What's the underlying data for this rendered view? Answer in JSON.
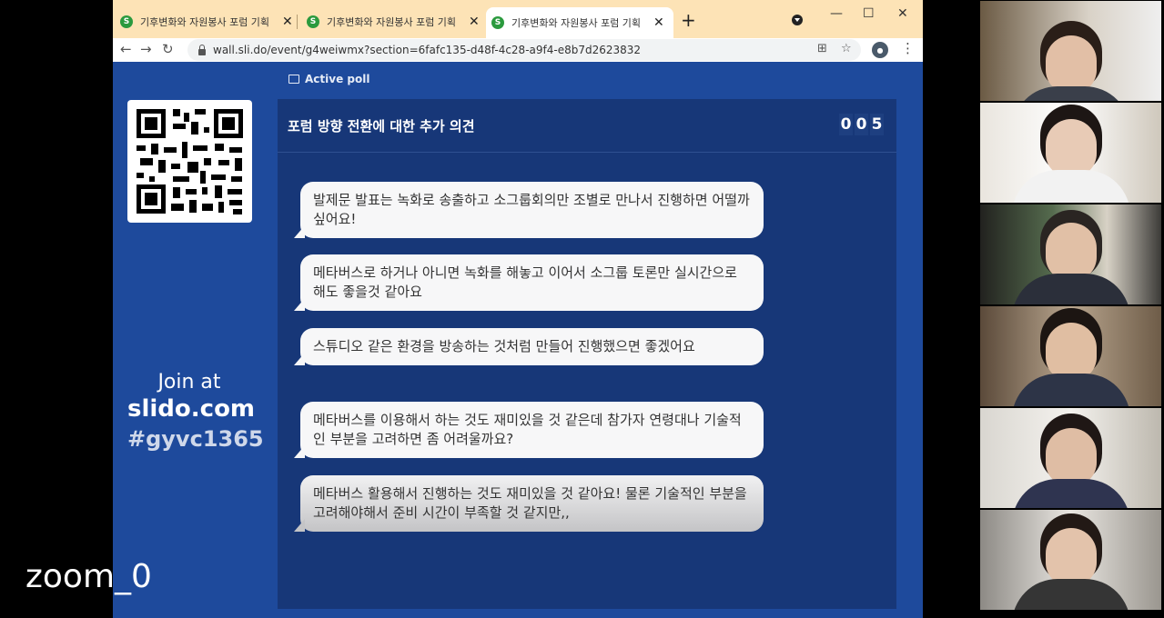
{
  "browser": {
    "tabs": [
      {
        "title": "기후변화와 자원봉사 포럼 기획",
        "favicon": "S",
        "active": false
      },
      {
        "title": "기후변화와 자원봉사 포럼 기획",
        "favicon": "S",
        "active": false
      },
      {
        "title": "기후변화와 자원봉사 포럼 기획",
        "favicon": "S",
        "active": true
      }
    ],
    "new_tab": "+",
    "url": "wall.sli.do/event/g4weiwmx?section=6fafc135-d48f-4c28-a9f4-e8b7d2623832"
  },
  "wall": {
    "join_at": "Join at",
    "site": "slido.com",
    "code": "#gyvc1365",
    "active_poll": "Active poll",
    "question_title": "포럼 방향 전환에 대한 추가 의견",
    "counter": [
      "0",
      "0",
      "5"
    ],
    "responses": [
      "발제문 발표는 녹화로 송출하고 소그룹회의만 조별로 만나서 진행하면 어떨까 싶어요!",
      "메타버스로 하거나 아니면 녹화를 해놓고 이어서 소그룹 토론만 실시간으로 해도 좋을것 같아요",
      "스튜디오 같은 환경을 방송하는 것처럼 만들어 진행했으면 좋겠어요",
      "메타버스를 이용해서 하는 것도 재미있을 것 같은데 참가자 연령대나 기술적인 부분을 고려하면 좀 어려울까요?",
      "메타버스 활용해서 진행하는 것도 재미있을 것 같아요! 물론 기술적인 부분을 고려해야해서 준비 시간이 부족할 것 같지만,,"
    ]
  },
  "watermark": "zoom_0",
  "colors": {
    "wall_bg": "#1e4a9c",
    "panel_bg": "#173778",
    "tabbar_bg": "#fde3b6",
    "favicon": "#2b9a3e"
  }
}
